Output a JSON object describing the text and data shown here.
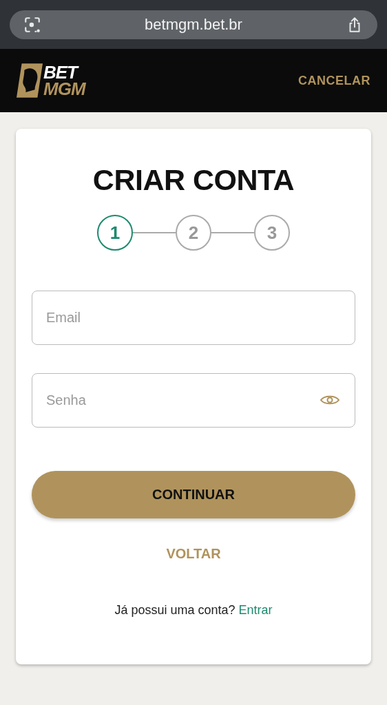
{
  "browser": {
    "url": "betmgm.bet.br"
  },
  "header": {
    "logo": {
      "top": "BET",
      "bottom": "MGM"
    },
    "cancel": "CANCELAR"
  },
  "form": {
    "title": "CRIAR CONTA",
    "steps": [
      {
        "label": "1",
        "selected": true
      },
      {
        "label": "2",
        "selected": false
      },
      {
        "label": "3",
        "selected": false
      }
    ],
    "fields": [
      {
        "kind": "text",
        "placeholder": "Email"
      },
      {
        "kind": "password",
        "placeholder": "Senha"
      }
    ],
    "submit": "CONTINUAR",
    "back": "VOLTAR",
    "login_prompt": {
      "text": "Já possui uma conta?",
      "link": "Entrar"
    }
  }
}
